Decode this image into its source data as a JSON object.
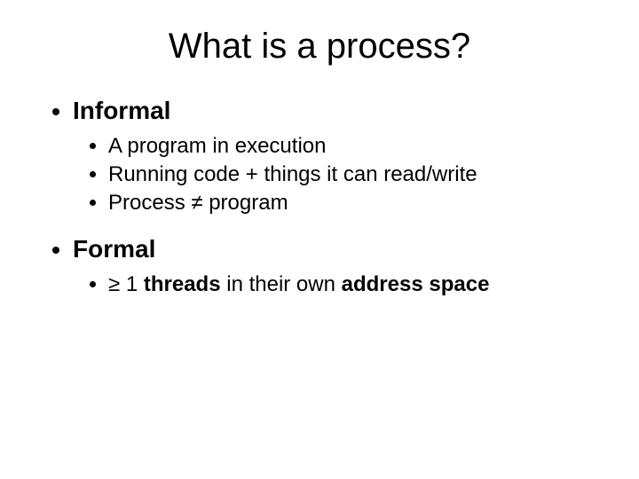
{
  "title": "What is a process?",
  "sections": [
    {
      "heading": "Informal",
      "items": [
        {
          "text": "A program in execution"
        },
        {
          "text": "Running code + things it can read/write"
        },
        {
          "text": "Process ≠ program"
        }
      ]
    },
    {
      "heading": "Formal",
      "items": [
        {
          "prefix": "≥ 1 ",
          "bold1": "threads",
          "mid": " in their own ",
          "bold2": "address space"
        }
      ]
    }
  ]
}
